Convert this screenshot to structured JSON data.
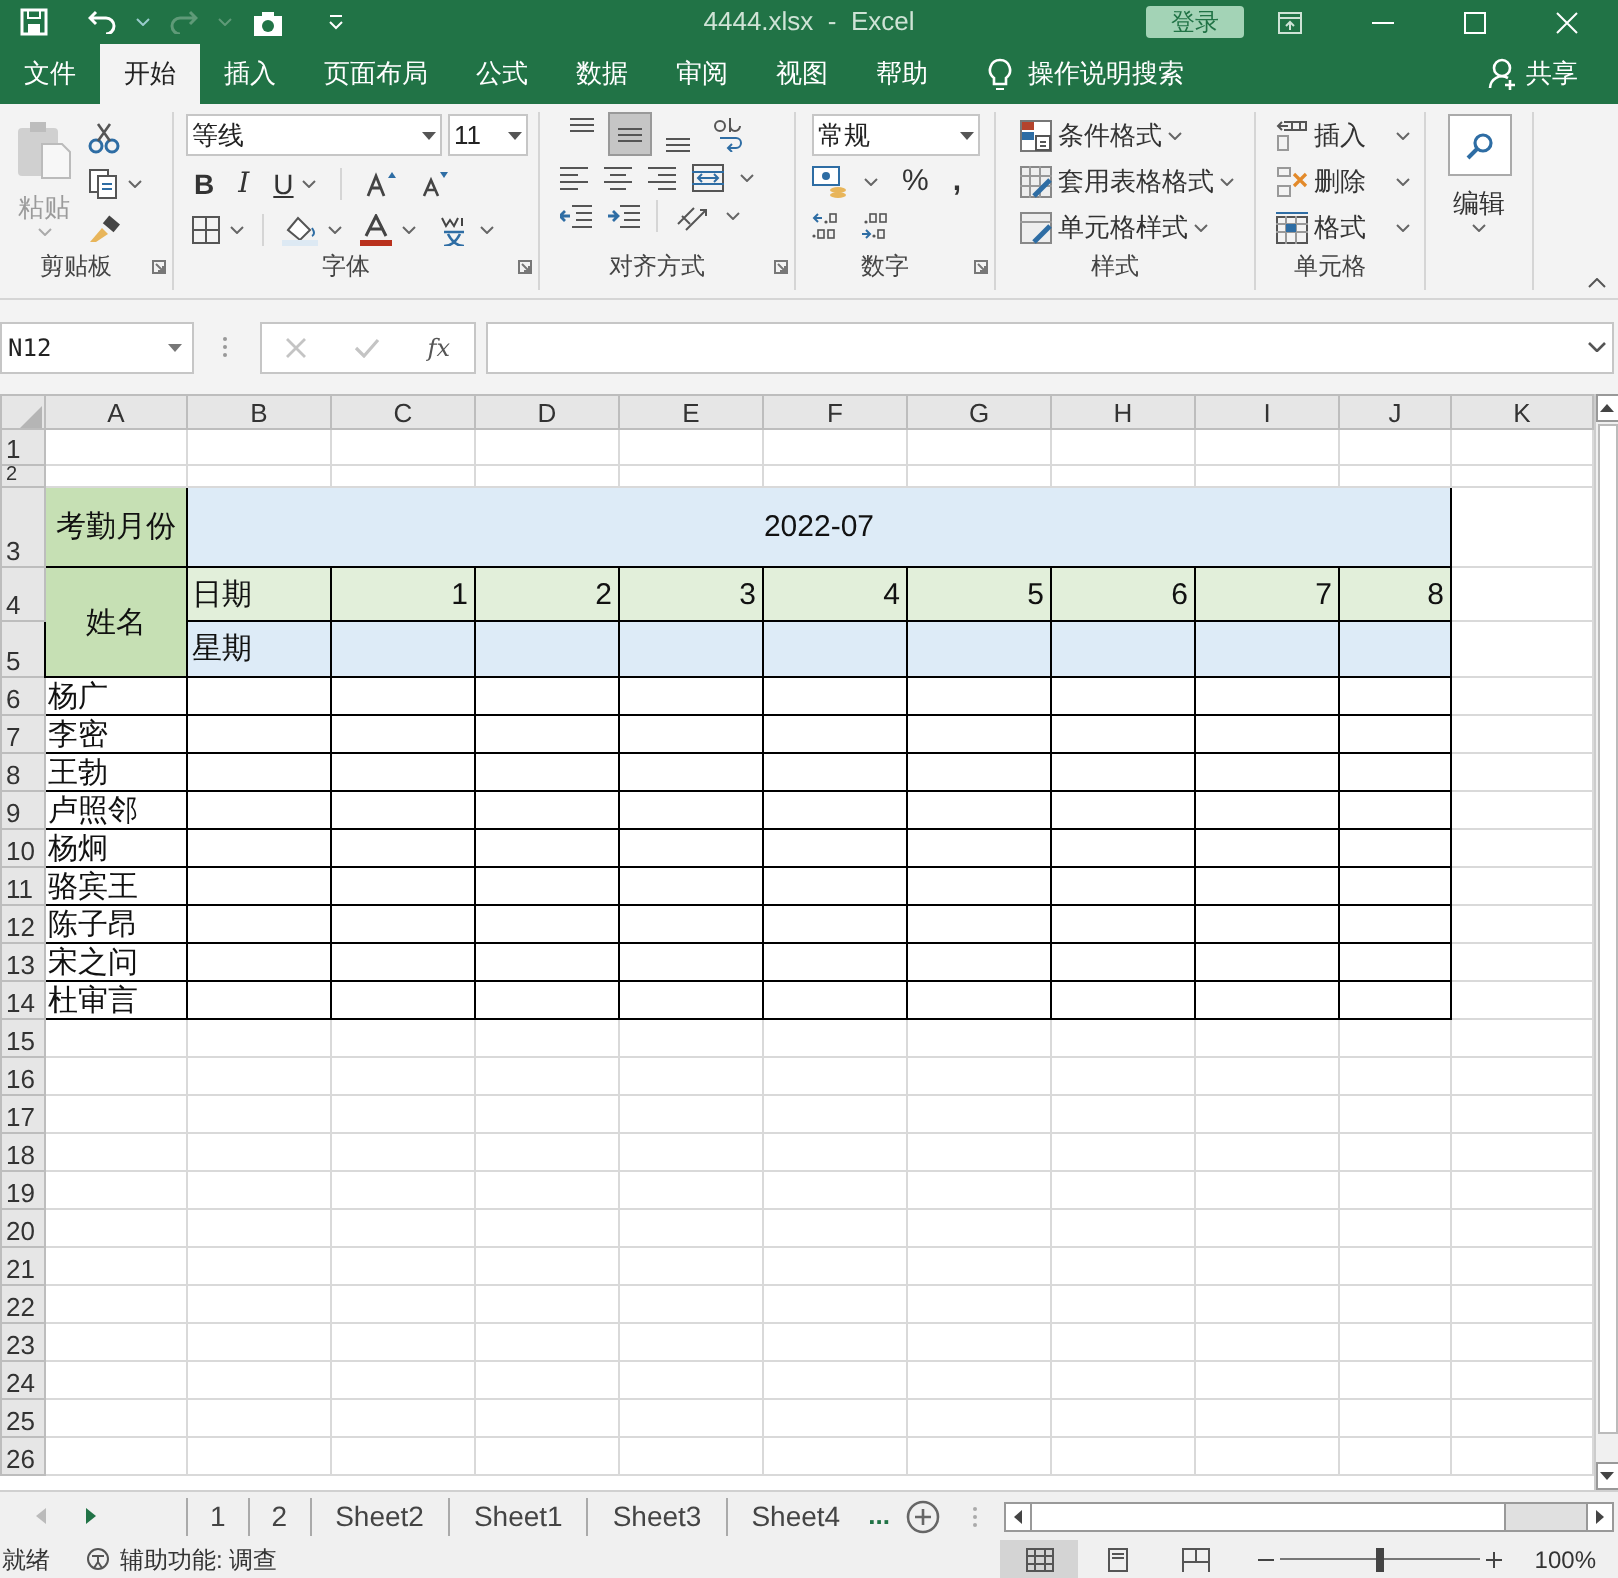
{
  "window": {
    "title": "4444.xlsx  -  Excel",
    "sign_in": "登录"
  },
  "ribbon_tabs": [
    {
      "label": "文件",
      "selected": false
    },
    {
      "label": "开始",
      "selected": true
    },
    {
      "label": "插入",
      "selected": false
    },
    {
      "label": "页面布局",
      "selected": false
    },
    {
      "label": "公式",
      "selected": false
    },
    {
      "label": "数据",
      "selected": false
    },
    {
      "label": "审阅",
      "selected": false
    },
    {
      "label": "视图",
      "selected": false
    },
    {
      "label": "帮助",
      "selected": false
    }
  ],
  "tell_me": "操作说明搜索",
  "share": "共享",
  "clipboard": {
    "paste": "粘贴",
    "label": "剪贴板"
  },
  "font": {
    "name": "等线",
    "size": "11",
    "style_buttons": [
      "B",
      "I",
      "U"
    ],
    "label": "字体"
  },
  "alignment": {
    "vertical_align": [
      {
        "kind": "top",
        "selected": false
      },
      {
        "kind": "middle",
        "selected": true
      },
      {
        "kind": "bottom",
        "selected": false
      }
    ],
    "label": "对齐方式"
  },
  "number": {
    "format": "常规",
    "symbols": [
      "%",
      ","
    ],
    "label": "数字"
  },
  "styles": {
    "items": [
      {
        "label": "条件格式",
        "kind": "conditional"
      },
      {
        "label": "套用表格格式",
        "kind": "table"
      },
      {
        "label": "单元格样式",
        "kind": "cell"
      }
    ],
    "label": "样式"
  },
  "cells": {
    "items": [
      {
        "label": "插入",
        "kind": "insert"
      },
      {
        "label": "删除",
        "kind": "delete"
      },
      {
        "label": "格式",
        "kind": "format"
      }
    ],
    "label": "单元格"
  },
  "editing": {
    "label": "编辑"
  },
  "formula_bar": {
    "name_box": "N12",
    "function_label": "fx"
  },
  "sheet": {
    "columns": [
      "A",
      "B",
      "C",
      "D",
      "E",
      "F",
      "G",
      "H",
      "I",
      "J",
      "K"
    ],
    "row_numbers": [
      "1",
      "2",
      "3",
      "4",
      "5",
      "6",
      "7",
      "8",
      "9",
      "10",
      "11",
      "12",
      "13",
      "14",
      "15",
      "16",
      "17",
      "18",
      "19",
      "20",
      "21",
      "22",
      "23",
      "24",
      "25",
      "26"
    ],
    "month_label": "考勤月份",
    "month": "2022-07",
    "name_label": "姓名",
    "date_label": "日期",
    "days": [
      "1",
      "2",
      "3",
      "4",
      "5",
      "6",
      "7",
      "8"
    ],
    "weekday_label": "星期",
    "names": [
      "杨广",
      "李密",
      "王勃",
      "卢照邻",
      "杨炯",
      "骆宾王",
      "陈子昂",
      "宋之问",
      "杜审言"
    ]
  },
  "sheet_tabs": [
    {
      "label": "1",
      "selected": false
    },
    {
      "label": "2",
      "selected": false
    },
    {
      "label": "Sheet2",
      "selected": false
    },
    {
      "label": "Sheet1",
      "selected": false
    },
    {
      "label": "Sheet3",
      "selected": false
    },
    {
      "label": "Sheet4",
      "selected": false
    }
  ],
  "more_tabs": "...",
  "status_bar": {
    "status": "就绪",
    "accessibility": "辅助功能: 调查",
    "views": [
      {
        "kind": "normal",
        "selected": true
      },
      {
        "kind": "page_layout",
        "selected": false
      },
      {
        "kind": "page_break",
        "selected": false
      }
    ],
    "zoom": {
      "level": 0.5,
      "reading": "100%"
    }
  }
}
